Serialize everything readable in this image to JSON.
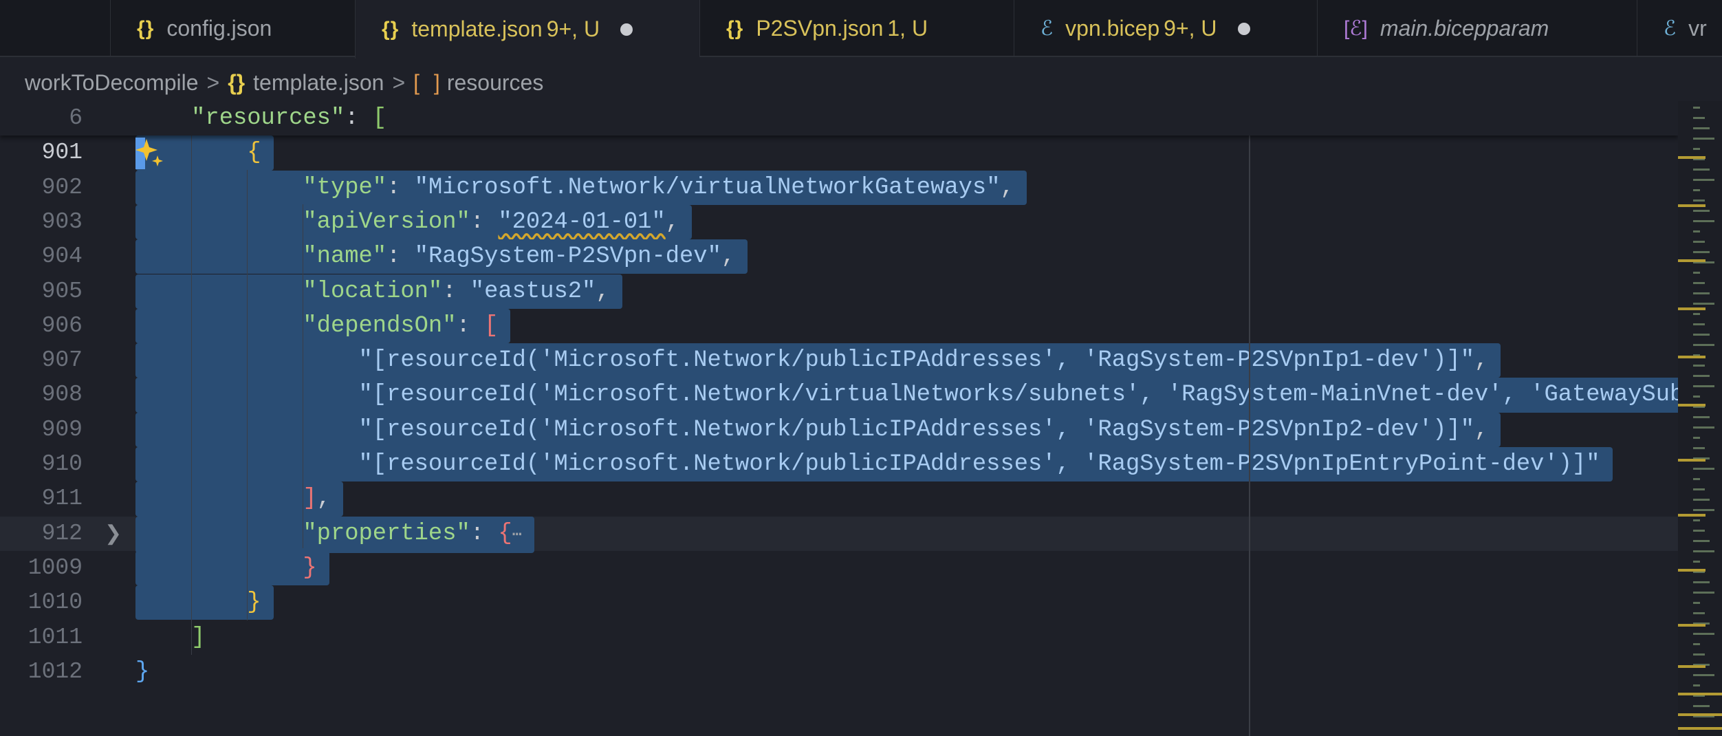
{
  "tabs": [
    {
      "icon": "json-braces-icon",
      "glyph": "{}",
      "iconClass": "json",
      "label": "config.json",
      "status": "",
      "dirty": false,
      "modified": false,
      "italic": false,
      "active": false
    },
    {
      "icon": "json-braces-icon",
      "glyph": "{}",
      "iconClass": "json",
      "label": "template.json",
      "status": "9+, U",
      "dirty": true,
      "modified": true,
      "italic": false,
      "active": true
    },
    {
      "icon": "json-braces-icon",
      "glyph": "{}",
      "iconClass": "json",
      "label": "P2SVpn.json",
      "status": "1, U",
      "dirty": false,
      "modified": true,
      "italic": false,
      "active": false
    },
    {
      "icon": "bicep-icon",
      "glyph": "ℰ",
      "iconClass": "bicep",
      "label": "vpn.bicep",
      "status": "9+, U",
      "dirty": true,
      "modified": true,
      "italic": false,
      "active": false
    },
    {
      "icon": "bicepparam-icon",
      "glyph": "[ℰ]",
      "iconClass": "param",
      "label": "main.bicepparam",
      "status": "",
      "dirty": false,
      "modified": false,
      "italic": true,
      "active": false
    },
    {
      "icon": "bicep-icon",
      "glyph": "ℰ",
      "iconClass": "bicep",
      "label": "vr",
      "status": "",
      "dirty": false,
      "modified": false,
      "italic": false,
      "active": false
    }
  ],
  "breadcrumb": {
    "folder": "workToDecompile",
    "separator": ">",
    "file_icon": "{}",
    "file": "template.json",
    "symbol_icon": "[ ]",
    "symbol": "resources"
  },
  "editor": {
    "lines": [
      {
        "num": "6",
        "indent": 4,
        "sticky": true,
        "tokens": [
          [
            "k",
            "\"resources\""
          ],
          [
            "p",
            ": "
          ],
          [
            "b2",
            "["
          ]
        ]
      },
      {
        "num": "901",
        "indent": 8,
        "sel": true,
        "active": true,
        "tokens": [
          [
            "b3",
            "{"
          ]
        ]
      },
      {
        "num": "902",
        "indent": 12,
        "sel": true,
        "tokens": [
          [
            "k",
            "\"type\""
          ],
          [
            "p",
            ": "
          ],
          [
            "s",
            "\"Microsoft.Network/virtualNetworkGateways\""
          ],
          [
            "p",
            ","
          ]
        ]
      },
      {
        "num": "903",
        "indent": 12,
        "sel": true,
        "tokens": [
          [
            "k",
            "\"apiVersion\""
          ],
          [
            "p",
            ": "
          ],
          [
            "s sq",
            "\"2024-01-01\""
          ],
          [
            "p",
            ","
          ]
        ]
      },
      {
        "num": "904",
        "indent": 12,
        "sel": true,
        "tokens": [
          [
            "k",
            "\"name\""
          ],
          [
            "p",
            ": "
          ],
          [
            "s",
            "\"RagSystem-P2SVpn-dev\""
          ],
          [
            "p",
            ","
          ]
        ]
      },
      {
        "num": "905",
        "indent": 12,
        "sel": true,
        "tokens": [
          [
            "k",
            "\"location\""
          ],
          [
            "p",
            ": "
          ],
          [
            "s",
            "\"eastus2\""
          ],
          [
            "p",
            ","
          ]
        ]
      },
      {
        "num": "906",
        "indent": 12,
        "sel": true,
        "tokens": [
          [
            "k",
            "\"dependsOn\""
          ],
          [
            "p",
            ": "
          ],
          [
            "b4",
            "["
          ]
        ]
      },
      {
        "num": "907",
        "indent": 16,
        "sel": true,
        "tokens": [
          [
            "s",
            "\"[resourceId('Microsoft.Network/publicIPAddresses', 'RagSystem-P2SVpnIp1-dev')]\""
          ],
          [
            "p",
            ","
          ]
        ]
      },
      {
        "num": "908",
        "indent": 16,
        "sel": true,
        "tokens": [
          [
            "s",
            "\"[resourceId('Microsoft.Network/virtualNetworks/subnets', 'RagSystem-MainVnet-dev', 'GatewaySub"
          ]
        ]
      },
      {
        "num": "909",
        "indent": 16,
        "sel": true,
        "tokens": [
          [
            "s",
            "\"[resourceId('Microsoft.Network/publicIPAddresses', 'RagSystem-P2SVpnIp2-dev')]\""
          ],
          [
            "p",
            ","
          ]
        ]
      },
      {
        "num": "910",
        "indent": 16,
        "sel": true,
        "tokens": [
          [
            "s",
            "\"[resourceId('Microsoft.Network/publicIPAddresses', 'RagSystem-P2SVpnIpEntryPoint-dev')]\""
          ]
        ]
      },
      {
        "num": "911",
        "indent": 12,
        "sel": true,
        "tokens": [
          [
            "b4",
            "]"
          ],
          [
            "p",
            ","
          ]
        ]
      },
      {
        "num": "912",
        "indent": 12,
        "sel": true,
        "current": true,
        "folded": true,
        "tokens": [
          [
            "k",
            "\"properties\""
          ],
          [
            "p",
            ": "
          ],
          [
            "b4",
            "{"
          ],
          [
            "fold",
            "⋯"
          ]
        ]
      },
      {
        "num": "1009",
        "indent": 12,
        "sel": true,
        "tokens": [
          [
            "b4",
            "}"
          ]
        ]
      },
      {
        "num": "1010",
        "indent": 8,
        "sel": true,
        "tokens": [
          [
            "b3",
            "}"
          ]
        ]
      },
      {
        "num": "1011",
        "indent": 4,
        "tokens": [
          [
            "b2",
            "]"
          ]
        ]
      },
      {
        "num": "1012",
        "indent": 0,
        "tokens": [
          [
            "b1",
            "}"
          ]
        ]
      }
    ]
  },
  "colors": {
    "selection": "#2a4d74",
    "background": "#1e2028",
    "minimap_highlight": "#b39b33"
  }
}
